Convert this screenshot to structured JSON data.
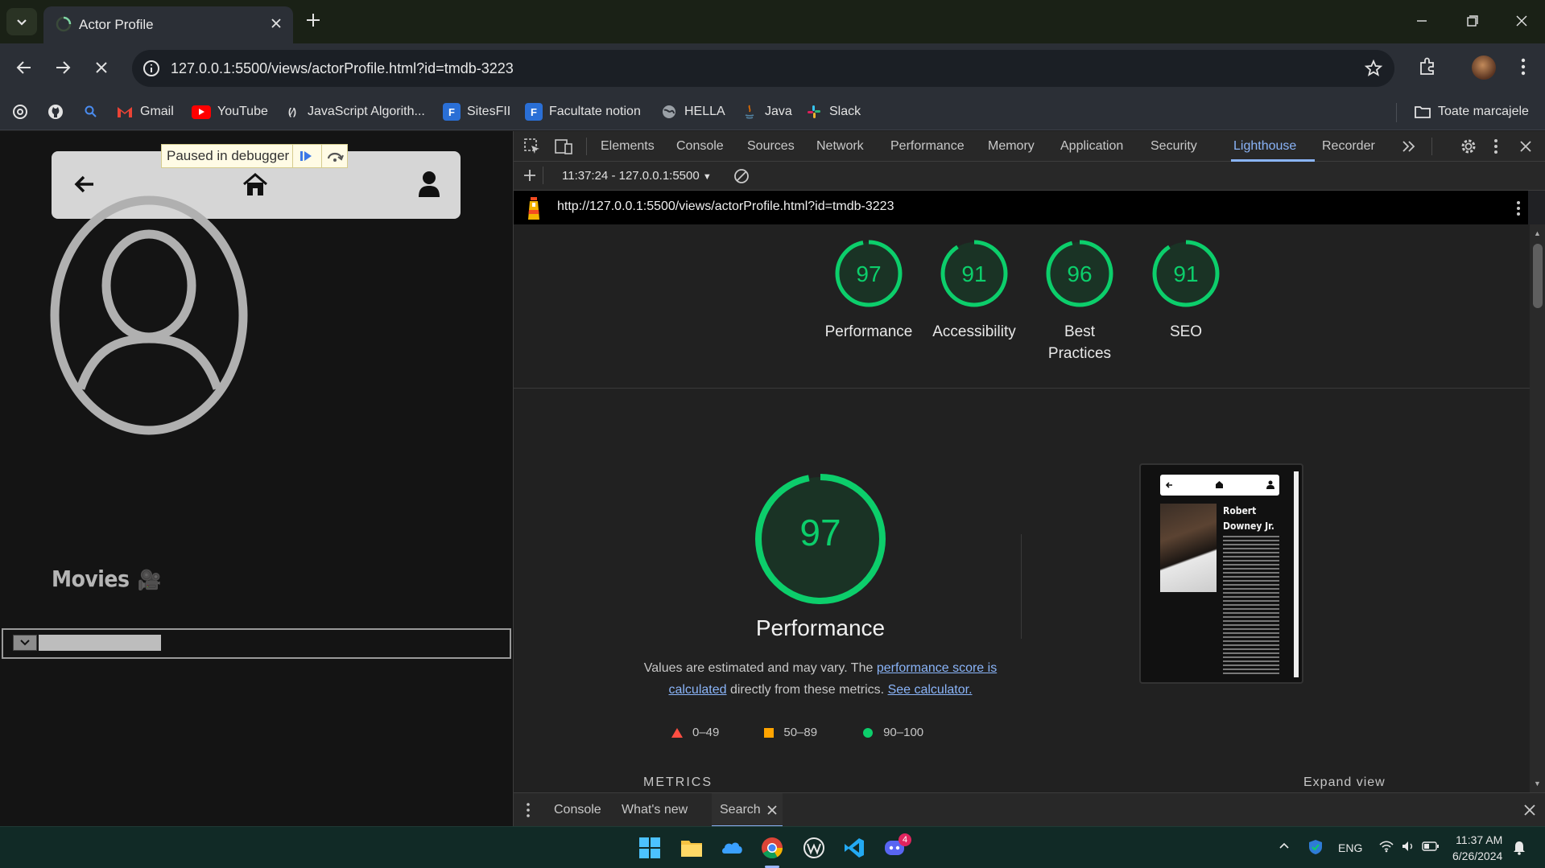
{
  "browser": {
    "tab_title": "Actor Profile",
    "url": "127.0.0.1:5500/views/actorProfile.html?id=tmdb-3223"
  },
  "bookmarks": {
    "items": [
      "Gmail",
      "YouTube",
      "JavaScript Algorith...",
      "SitesFII",
      "Facultate notion",
      "HELLA",
      "Java",
      "Slack"
    ],
    "all_bookmarks": "Toate marcajele"
  },
  "page": {
    "debugger_banner": "Paused in debugger",
    "movies_heading": "Movies",
    "movies_emoji": "🎥"
  },
  "devtools": {
    "tabs": [
      "Elements",
      "Console",
      "Sources",
      "Network",
      "Performance",
      "Memory",
      "Application",
      "Security",
      "Lighthouse",
      "Recorder"
    ],
    "active_tab": "Lighthouse",
    "report_selector": "11:37:24 - 127.0.0.1:5500",
    "report_url": "http://127.0.0.1:5500/views/actorProfile.html?id=tmdb-3223",
    "scores": [
      {
        "label": "Performance",
        "score": 97
      },
      {
        "label": "Accessibility",
        "score": 91
      },
      {
        "label": "Best Practices",
        "score": 96
      },
      {
        "label": "SEO",
        "score": 91
      }
    ],
    "performance": {
      "score": 97,
      "title": "Performance",
      "desc_prefix": "Values are estimated and may vary. The ",
      "link_score": "performance score is calculated",
      "desc_middle": " directly from these metrics. ",
      "link_calc": "See calculator."
    },
    "legend": {
      "fail": "0–49",
      "average": "50–89",
      "pass": "90–100"
    },
    "metrics_label": "METRICS",
    "expand_view": "Expand view",
    "screenshot": {
      "name": "Robert Downey Jr."
    },
    "drawer_tabs": [
      "Console",
      "What's new",
      "Search"
    ],
    "colors": {
      "pass": "#0cce6b",
      "average": "#ffa400",
      "fail": "#ff4e42",
      "accent": "#8ab4f8"
    }
  },
  "taskbar": {
    "language": "ENG",
    "time": "11:37 AM",
    "date": "6/26/2024",
    "discord_badge": "4"
  }
}
